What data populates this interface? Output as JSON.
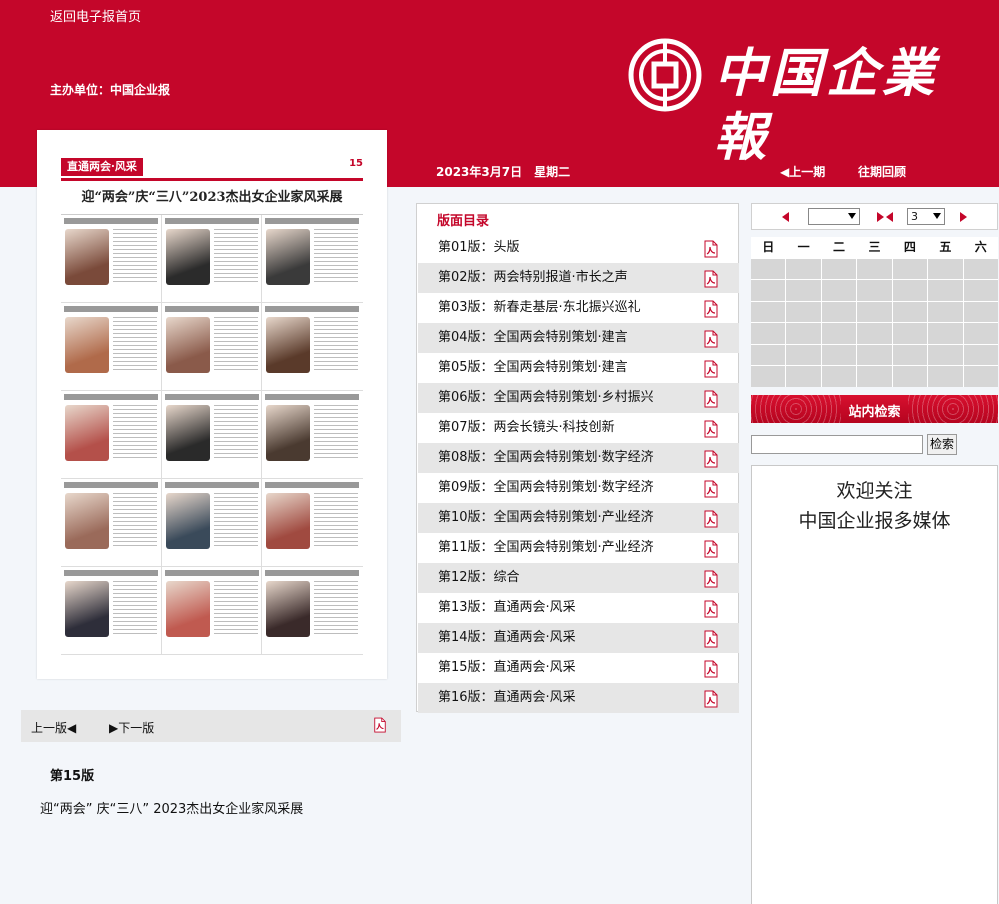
{
  "header": {
    "home_link": "返回电子报首页",
    "host": "主办单位：中国企业报",
    "logo_text": "中国企業報",
    "date": "2023年3月7日　星期二",
    "prev_issue": "◀上一期",
    "past_review": "往期回顾"
  },
  "thumbnail": {
    "badge": "直通两会·风采",
    "page_no": "15",
    "title": "迎“两会”庆“三八”2023杰出女企业家风采展",
    "photo_colors": [
      "#7a4a3a",
      "#2b2b2b",
      "#3a3a3a",
      "#b06a4a",
      "#8a5a4a",
      "#5a3a2a",
      "#b4504a",
      "#2a2a2a",
      "#4a3a30",
      "#9a6a5a",
      "#3a4a5a",
      "#a04a40",
      "#2e2e3a",
      "#c05a50",
      "#3a2a2a"
    ]
  },
  "pager": {
    "prev": "上一版◀",
    "next": "▶下一版",
    "pdf_icon": "pdf-icon"
  },
  "current": {
    "page": "第15版",
    "article": "迎“两会” 庆“三八” 2023杰出女企业家风采展"
  },
  "toc": {
    "title": "版面目录",
    "items": [
      {
        "label": "第01版：头版"
      },
      {
        "label": "第02版：两会特别报道·市长之声"
      },
      {
        "label": "第03版：新春走基层·东北振兴巡礼"
      },
      {
        "label": "第04版：全国两会特别策划·建言"
      },
      {
        "label": "第05版：全国两会特别策划·建言"
      },
      {
        "label": "第06版：全国两会特别策划·乡村振兴"
      },
      {
        "label": "第07版：两会长镜头·科技创新"
      },
      {
        "label": "第08版：全国两会特别策划·数字经济"
      },
      {
        "label": "第09版：全国两会特别策划·数字经济"
      },
      {
        "label": "第10版：全国两会特别策划·产业经济"
      },
      {
        "label": "第11版：全国两会特别策划·产业经济"
      },
      {
        "label": "第12版：综合"
      },
      {
        "label": "第13版：直通两会·风采"
      },
      {
        "label": "第14版：直通两会·风采"
      },
      {
        "label": "第15版：直通两会·风采"
      },
      {
        "label": "第16版：直通两会·风采"
      }
    ]
  },
  "calendar": {
    "year_value": "",
    "month_value": "3",
    "weekdays": [
      "日",
      "一",
      "二",
      "三",
      "四",
      "五",
      "六"
    ]
  },
  "search": {
    "banner": "站内检索",
    "button": "检索",
    "placeholder": ""
  },
  "media": {
    "line1": "欢迎关注",
    "line2": "中国企业报多媒体"
  },
  "colors": {
    "brand_red": "#c4062a",
    "page_bg": "#f3f6fa",
    "row_alt": "#e6e6e6"
  }
}
